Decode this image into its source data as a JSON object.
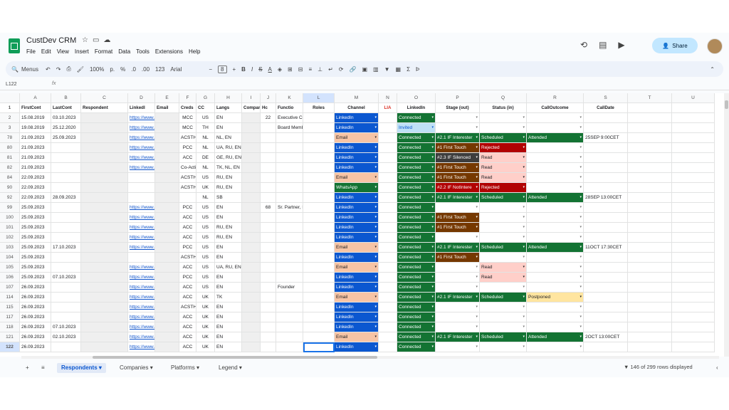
{
  "app": {
    "title": "CustDev CRM",
    "menus": [
      "File",
      "Edit",
      "View",
      "Insert",
      "Format",
      "Data",
      "Tools",
      "Extensions",
      "Help"
    ],
    "share_label": "Share"
  },
  "toolbar": {
    "search_label": "Menus",
    "zoom": "100%",
    "currency": "р.",
    "percent": "%",
    "dec_less": ".0",
    "dec_more": ".00",
    "num_format": "123",
    "font": "Arial",
    "font_size": "8"
  },
  "formula": {
    "cell_ref": "L122",
    "fx": "fx"
  },
  "columns": [
    "A",
    "B",
    "C",
    "D",
    "E",
    "F",
    "G",
    "H",
    "I",
    "J",
    "K",
    "L",
    "M",
    "N",
    "O",
    "P",
    "Q",
    "R",
    "S",
    "T",
    "U"
  ],
  "headers": [
    "FirstCont",
    "LastCont",
    "Respondent",
    "LinkedI",
    "Email",
    "Creds",
    "CC",
    "Langs",
    "Compar",
    "Hc",
    "Functio",
    "Roles",
    "Channel",
    "LIA",
    "LinkedIn",
    "Stage (out)",
    "Status (in)",
    "CallOutcome",
    "CallDate",
    "",
    ""
  ],
  "rows": [
    {
      "n": "1",
      "cells": []
    },
    {
      "n": "2",
      "cells": [
        "15.08.2019",
        "03.10.2023",
        "",
        "https://www.l",
        "",
        "MCC",
        "US",
        "EN",
        "",
        "22",
        "Executive Co",
        "",
        "LinkedIn",
        "",
        "Connected",
        "",
        "",
        "",
        "",
        "",
        ""
      ]
    },
    {
      "n": "3",
      "cells": [
        "19.08.2019",
        "25.12.2020",
        "",
        "https://www.l",
        "",
        "MCC",
        "TH",
        "EN",
        "",
        "",
        "Board Memb",
        "",
        "LinkedIn",
        "",
        "Invited",
        "",
        "",
        "",
        "",
        "",
        ""
      ]
    },
    {
      "n": "78",
      "cells": [
        "21.09.2023",
        "25.09.2023",
        "",
        "https://www.l",
        "",
        "ACSTH",
        "NL",
        "NL, EN",
        "",
        "",
        "",
        "",
        "Email",
        "",
        "Connected",
        "#2.1 IF Interester",
        "Scheduled",
        "Attended",
        "25SEP 9:00CET",
        "",
        ""
      ]
    },
    {
      "n": "80",
      "cells": [
        "21.09.2023",
        "",
        "",
        "https://www.l",
        "",
        "PCC",
        "NL",
        "UA, RU, EN",
        "",
        "",
        "",
        "",
        "LinkedIn",
        "",
        "Connected",
        "#1 First Touch",
        "Rejected",
        "",
        "",
        "",
        ""
      ]
    },
    {
      "n": "81",
      "cells": [
        "21.09.2023",
        "",
        "",
        "https://www.l",
        "",
        "ACC",
        "DE",
        "GE, RU, EN",
        "",
        "",
        "",
        "",
        "LinkedIn",
        "",
        "Connected",
        "#2.3 IF Silenced",
        "Read",
        "",
        "",
        "",
        ""
      ]
    },
    {
      "n": "82",
      "cells": [
        "21.09.2023",
        "",
        "",
        "https://www.l",
        "",
        "Co-Active",
        "NL",
        "TK, NL, EN",
        "",
        "",
        "",
        "",
        "LinkedIn",
        "",
        "Connected",
        "#1 First Touch",
        "Read",
        "",
        "",
        "",
        ""
      ]
    },
    {
      "n": "84",
      "cells": [
        "22.09.2023",
        "",
        "",
        "",
        "",
        "ACSTH",
        "US",
        "RU, EN",
        "",
        "",
        "",
        "",
        "Email",
        "",
        "Connected",
        "#1 First Touch",
        "Read",
        "",
        "",
        "",
        ""
      ]
    },
    {
      "n": "90",
      "cells": [
        "22.09.2023",
        "",
        "",
        "",
        "",
        "ACSTH",
        "UK",
        "RU, EN",
        "",
        "",
        "",
        "",
        "WhatsApp",
        "",
        "Connected",
        "#2.2 IF NotIntere",
        "Rejected",
        "",
        "",
        "",
        ""
      ]
    },
    {
      "n": "92",
      "cells": [
        "22.09.2023",
        "28.09.2023",
        "",
        "",
        "",
        "",
        "NL",
        "SB",
        "",
        "",
        "",
        "",
        "LinkedIn",
        "",
        "Connected",
        "#2.1 IF Interester",
        "Scheduled",
        "Attended",
        "28SEP 13:00CET",
        "",
        ""
      ]
    },
    {
      "n": "99",
      "cells": [
        "25.09.2023",
        "",
        "",
        "https://www.l",
        "",
        "PCC",
        "US",
        "EN",
        "",
        "68",
        "Sr. Partner, E",
        "",
        "LinkedIn",
        "",
        "Connected",
        "",
        "",
        "",
        "",
        "",
        ""
      ]
    },
    {
      "n": "100",
      "cells": [
        "25.09.2023",
        "",
        "",
        "https://www.l",
        "",
        "ACC",
        "US",
        "EN",
        "",
        "",
        "",
        "",
        "LinkedIn",
        "",
        "Connected",
        "#1 First Touch",
        "",
        "",
        "",
        "",
        ""
      ]
    },
    {
      "n": "101",
      "cells": [
        "25.09.2023",
        "",
        "",
        "https://www.l",
        "",
        "ACC",
        "US",
        "RU, EN",
        "",
        "",
        "",
        "",
        "LinkedIn",
        "",
        "Connected",
        "#1 First Touch",
        "",
        "",
        "",
        "",
        ""
      ]
    },
    {
      "n": "102",
      "cells": [
        "25.09.2023",
        "",
        "",
        "https://www.l",
        "",
        "ACC",
        "US",
        "RU, EN",
        "",
        "",
        "",
        "",
        "LinkedIn",
        "",
        "Connected",
        "",
        "",
        "",
        "",
        "",
        ""
      ]
    },
    {
      "n": "103",
      "cells": [
        "25.09.2023",
        "17.10.2023",
        "",
        "https://www.l",
        "",
        "PCC",
        "US",
        "EN",
        "",
        "",
        "",
        "",
        "Email",
        "",
        "Connected",
        "#2.1 IF Interester",
        "Scheduled",
        "Attended",
        "11OCT 17:30CET",
        "",
        ""
      ]
    },
    {
      "n": "104",
      "cells": [
        "25.09.2023",
        "",
        "",
        "",
        "",
        "ACSTH",
        "US",
        "EN",
        "",
        "",
        "",
        "",
        "LinkedIn",
        "",
        "Connected",
        "#1 First Touch",
        "",
        "",
        "",
        "",
        ""
      ]
    },
    {
      "n": "105",
      "cells": [
        "25.09.2023",
        "",
        "",
        "https://www.l",
        "",
        "ACC",
        "US",
        "UA, RU, EN",
        "",
        "",
        "",
        "",
        "Email",
        "",
        "Connected",
        "",
        "Read",
        "",
        "",
        "",
        ""
      ]
    },
    {
      "n": "106",
      "cells": [
        "25.09.2023",
        "07.10.2023",
        "",
        "https://www.l",
        "",
        "PCC",
        "US",
        "EN",
        "",
        "",
        "",
        "",
        "LinkedIn",
        "",
        "Connected",
        "",
        "Read",
        "",
        "",
        "",
        ""
      ]
    },
    {
      "n": "107",
      "cells": [
        "26.09.2023",
        "",
        "",
        "https://www.l",
        "",
        "ACC",
        "US",
        "EN",
        "",
        "",
        "Founder",
        "",
        "LinkedIn",
        "",
        "Connected",
        "",
        "",
        "",
        "",
        "",
        ""
      ]
    },
    {
      "n": "114",
      "cells": [
        "26.09.2023",
        "",
        "",
        "https://www.l",
        "",
        "ACC",
        "UK",
        "TK",
        "",
        "",
        "",
        "",
        "Email",
        "",
        "Connected",
        "#2.1 IF Interester",
        "Scheduled",
        "Postponed",
        "",
        "",
        ""
      ]
    },
    {
      "n": "115",
      "cells": [
        "26.09.2023",
        "",
        "",
        "https://www.l",
        "",
        "ACSTH",
        "UK",
        "EN",
        "",
        "",
        "",
        "",
        "LinkedIn",
        "",
        "Connected",
        "",
        "",
        "",
        "",
        "",
        ""
      ]
    },
    {
      "n": "117",
      "cells": [
        "26.09.2023",
        "",
        "",
        "https://www.l",
        "",
        "ACC",
        "UK",
        "EN",
        "",
        "",
        "",
        "",
        "LinkedIn",
        "",
        "Connected",
        "",
        "",
        "",
        "",
        "",
        ""
      ]
    },
    {
      "n": "118",
      "cells": [
        "26.09.2023",
        "07.10.2023",
        "",
        "https://www.l",
        "",
        "ACC",
        "UK",
        "EN",
        "",
        "",
        "",
        "",
        "LinkedIn",
        "",
        "Connected",
        "",
        "",
        "",
        "",
        "",
        ""
      ]
    },
    {
      "n": "121",
      "cells": [
        "26.09.2023",
        "02.10.2023",
        "",
        "https://www.l",
        "",
        "ACC",
        "UK",
        "EN",
        "",
        "",
        "",
        "",
        "Email",
        "",
        "Connected",
        "#2.1 IF Interester",
        "Scheduled",
        "Attended",
        "2OCT 13:00CET",
        "",
        ""
      ]
    },
    {
      "n": "122",
      "cells": [
        "26.09.2023",
        "",
        "",
        "https://www.l",
        "",
        "ACC",
        "UK",
        "EN",
        "",
        "",
        "",
        "",
        "LinkedIn",
        "",
        "Connected",
        "",
        "",
        "",
        "",
        "",
        ""
      ]
    }
  ],
  "sheets": [
    "Respondents",
    "Companies",
    "Platforms",
    "Legend"
  ],
  "status": {
    "rows_displayed": "146 of 299 rows displayed"
  },
  "colors": {
    "linkedin": "#0b57d0",
    "email": "#f7c4a5",
    "whatsapp": "#137333",
    "connected": "#137333",
    "invited": "#bfe1f6",
    "first_touch": "#753800",
    "interested": "#137333",
    "silenced": "#3d3d3d",
    "notinterested": "#b10202",
    "rejected": "#b10202",
    "read": "#ffcfc9",
    "scheduled": "#137333",
    "attended": "#137333",
    "postponed": "#ffe5a0"
  }
}
